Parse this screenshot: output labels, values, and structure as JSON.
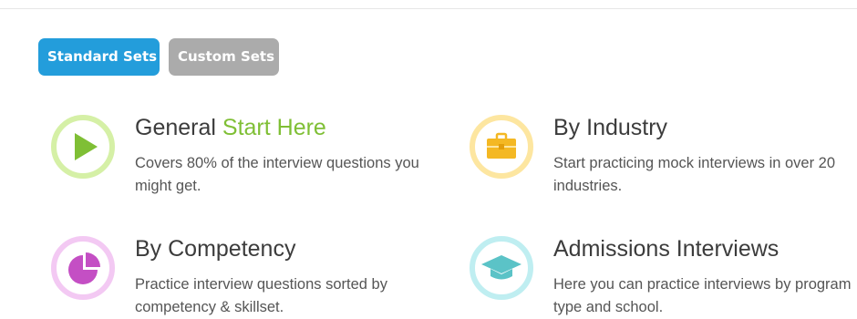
{
  "tabs": {
    "standard": "Standard Sets",
    "custom": "Custom Sets"
  },
  "cards": [
    {
      "title": "General",
      "title_accent": "Start Here",
      "description": "Covers 80% of the interview questions you might get.",
      "icon": "play-icon",
      "ring_color": "#d5f0a6",
      "fill_color": "#7fbf35"
    },
    {
      "title": "By Industry",
      "description": "Start practicing mock interviews in over 20 industries.",
      "icon": "briefcase-icon",
      "ring_color": "#fde6a0",
      "fill_color": "#f4b823"
    },
    {
      "title": "By Competency",
      "description": "Practice interview questions sorted by competency & skillset.",
      "icon": "pie-chart-icon",
      "ring_color": "#f3c9f3",
      "fill_color": "#c44fc4"
    },
    {
      "title": "Admissions Interviews",
      "description": "Here you can practice interviews by program type and school.",
      "icon": "graduation-cap-icon",
      "ring_color": "#bfeef1",
      "fill_color": "#5bc3c7"
    }
  ]
}
